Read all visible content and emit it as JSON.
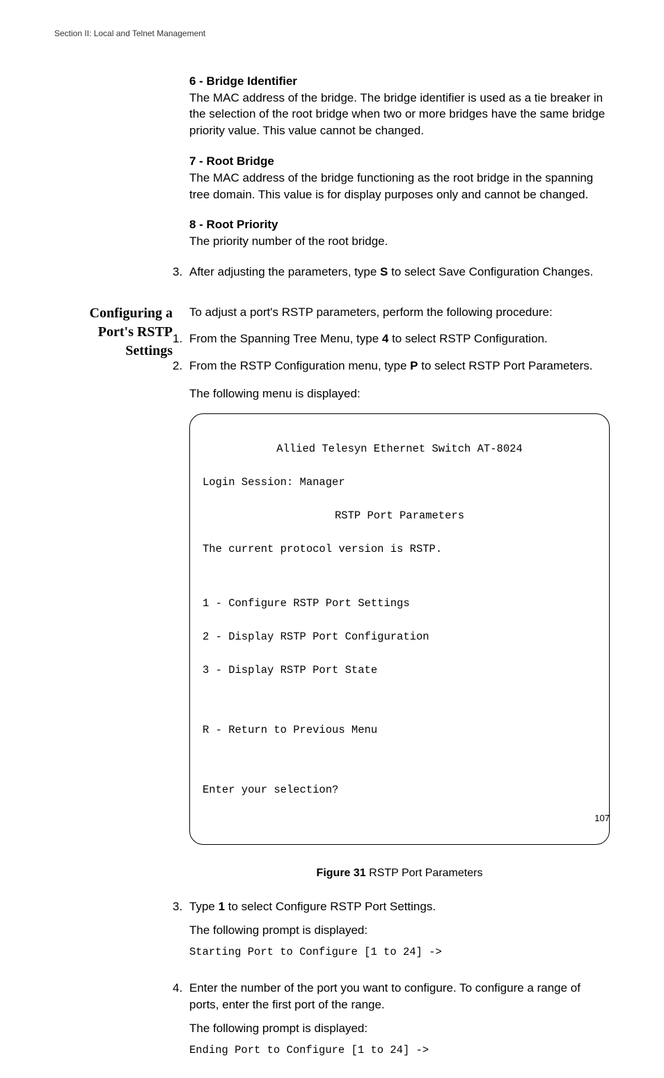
{
  "header": "Section II: Local and Telnet Management",
  "def6": {
    "title": "6 - Bridge Identifier",
    "body": "The MAC address of the bridge. The bridge identifier is used as a tie breaker in the selection of the root bridge when two or more bridges have the same bridge priority value. This value cannot be changed."
  },
  "def7": {
    "title": "7 - Root Bridge",
    "body": "The MAC address of the bridge functioning as the root bridge in the spanning tree domain. This value is for display purposes only and cannot be changed."
  },
  "def8": {
    "title": "8 - Root Priority",
    "body": "The priority number of the root bridge."
  },
  "stepA": {
    "num": "3.",
    "pre": "After adjusting the parameters, type ",
    "key": "S",
    "post": " to select Save Configuration Changes."
  },
  "section": {
    "line1": "Configuring a",
    "line2": "Port's RSTP",
    "line3": "Settings",
    "intro": "To adjust a port's RSTP parameters, perform the following procedure:"
  },
  "step1": {
    "num": "1.",
    "pre": "From the Spanning Tree Menu, type ",
    "key": "4",
    "post": " to select RSTP Configuration."
  },
  "step2": {
    "num": "2.",
    "pre": "From the RSTP Configuration menu, type ",
    "key": "P",
    "post": " to select RSTP Port Parameters.",
    "follow": "The following menu is displayed:"
  },
  "terminal": {
    "title": "Allied Telesyn Ethernet Switch AT-8024",
    "login": "Login Session: Manager",
    "subtitle": "RSTP Port Parameters",
    "proto": "The current protocol version is RSTP.",
    "opt1": "1 - Configure RSTP Port Settings",
    "opt2": "2 - Display RSTP Port Configuration",
    "opt3": "3 - Display RSTP Port State",
    "optR": "R - Return to Previous Menu",
    "prompt": "Enter your selection?"
  },
  "figure": {
    "label": "Figure 31",
    "text": "  RSTP Port Parameters"
  },
  "step3": {
    "num": "3.",
    "pre": "Type ",
    "key": "1",
    "post": " to select Configure RSTP Port Settings.",
    "follow": "The following prompt is displayed:",
    "mono": "Starting Port to Configure [1 to 24] ->"
  },
  "step4": {
    "num": "4.",
    "text": "Enter the number of the port you want to configure. To configure a range of ports, enter the first port of the range.",
    "follow": "The following prompt is displayed:",
    "mono": "Ending Port to Configure [1 to 24] ->"
  },
  "pageNum": "107"
}
